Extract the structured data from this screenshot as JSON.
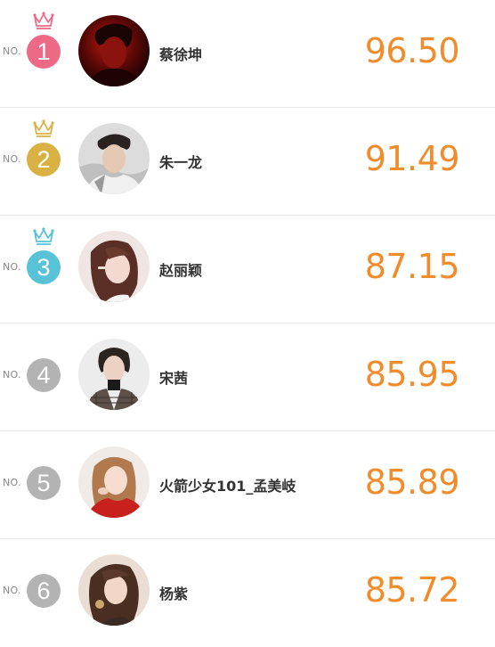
{
  "no_label": "NO.",
  "colors": {
    "score": "#f08c2c",
    "rank1": "#ec6a86",
    "rank2": "#d9b244",
    "rank3": "#58c2d6",
    "rank_default": "#b3b3b3"
  },
  "ranking": [
    {
      "rank": "1",
      "name": "蔡徐坤",
      "score": "96.50",
      "crown": "crown-icon",
      "avatar": "avatar-photo"
    },
    {
      "rank": "2",
      "name": "朱一龙",
      "score": "91.49",
      "crown": "crown-icon",
      "avatar": "avatar-photo"
    },
    {
      "rank": "3",
      "name": "赵丽颖",
      "score": "87.15",
      "crown": "crown-icon",
      "avatar": "avatar-photo"
    },
    {
      "rank": "4",
      "name": "宋茜",
      "score": "85.95",
      "avatar": "avatar-photo"
    },
    {
      "rank": "5",
      "name": "火箭少女101_孟美岐",
      "score": "85.89",
      "avatar": "avatar-photo"
    },
    {
      "rank": "6",
      "name": "杨紫",
      "score": "85.72",
      "avatar": "avatar-photo"
    }
  ]
}
